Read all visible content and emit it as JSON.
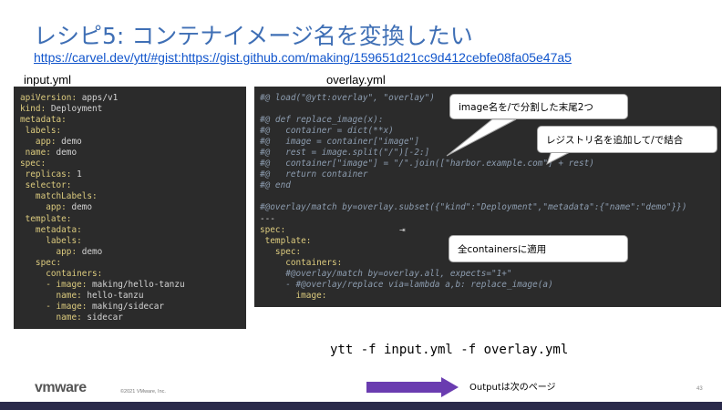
{
  "slide": {
    "title": "レシピ5: コンテナイメージ名を変換したい",
    "link": "https://carvel.dev/ytt/#gist:https://gist.github.com/making/159651d21cc9d412cebfe08fa05e47a5",
    "left_label": "input.yml",
    "right_label": "overlay.yml",
    "command": "ytt -f input.yml -f overlay.yml",
    "next_page": "Outputは次のページ",
    "copyright": "©2021 VMware, Inc.",
    "logo": "vmware",
    "page_number": "43"
  },
  "input_yml": [
    [
      {
        "t": "apiVersion:",
        "c": "k"
      },
      {
        "t": " apps/v1",
        "c": "v"
      }
    ],
    [
      {
        "t": "kind:",
        "c": "k"
      },
      {
        "t": " Deployment",
        "c": "v"
      }
    ],
    [
      {
        "t": "metadata:",
        "c": "k"
      }
    ],
    [
      {
        "t": " labels:",
        "c": "k"
      }
    ],
    [
      {
        "t": "   app:",
        "c": "k"
      },
      {
        "t": " demo",
        "c": "v"
      }
    ],
    [
      {
        "t": " name:",
        "c": "k"
      },
      {
        "t": " demo",
        "c": "v"
      }
    ],
    [
      {
        "t": "spec:",
        "c": "k"
      }
    ],
    [
      {
        "t": " replicas:",
        "c": "k"
      },
      {
        "t": " 1",
        "c": "v"
      }
    ],
    [
      {
        "t": " selector:",
        "c": "k"
      }
    ],
    [
      {
        "t": "   matchLabels:",
        "c": "k"
      }
    ],
    [
      {
        "t": "     app:",
        "c": "k"
      },
      {
        "t": " demo",
        "c": "v"
      }
    ],
    [
      {
        "t": " template:",
        "c": "k"
      }
    ],
    [
      {
        "t": "   metadata:",
        "c": "k"
      }
    ],
    [
      {
        "t": "     labels:",
        "c": "k"
      }
    ],
    [
      {
        "t": "       app:",
        "c": "k"
      },
      {
        "t": " demo",
        "c": "v"
      }
    ],
    [
      {
        "t": "   spec:",
        "c": "k"
      }
    ],
    [
      {
        "t": "     containers:",
        "c": "k"
      }
    ],
    [
      {
        "t": "     - image:",
        "c": "k"
      },
      {
        "t": " making/hello-tanzu",
        "c": "v"
      }
    ],
    [
      {
        "t": "       name:",
        "c": "k"
      },
      {
        "t": " hello-tanzu",
        "c": "v"
      }
    ],
    [
      {
        "t": "     - image:",
        "c": "k"
      },
      {
        "t": " making/sidecar",
        "c": "v"
      }
    ],
    [
      {
        "t": "       name:",
        "c": "k"
      },
      {
        "t": " sidecar",
        "c": "v"
      }
    ]
  ],
  "overlay_yml": [
    [
      {
        "t": "#@ load(\"@ytt:overlay\", \"overlay\")",
        "c": "cm"
      }
    ],
    [
      {
        "t": "",
        "c": "v"
      }
    ],
    [
      {
        "t": "#@ def replace_image(x):",
        "c": "cm"
      }
    ],
    [
      {
        "t": "#@   container = dict(**x)",
        "c": "cm"
      }
    ],
    [
      {
        "t": "#@   image = container[\"image\"]",
        "c": "cm"
      }
    ],
    [
      {
        "t": "#@   rest = image.split(\"/\")[-2:]",
        "c": "cm"
      }
    ],
    [
      {
        "t": "#@   container[\"image\"] = \"/\".join([\"harbor.example.com\"] + rest)",
        "c": "cm"
      }
    ],
    [
      {
        "t": "#@   return container",
        "c": "cm"
      }
    ],
    [
      {
        "t": "#@ end",
        "c": "cm"
      }
    ],
    [
      {
        "t": "",
        "c": "v"
      }
    ],
    [
      {
        "t": "#@overlay/match by=overlay.subset({\"kind\":\"Deployment\",\"metadata\":{\"name\":\"demo\"}})",
        "c": "cm"
      }
    ],
    [
      {
        "t": "---",
        "c": "v"
      }
    ],
    [
      {
        "t": "spec:",
        "c": "k"
      }
    ],
    [
      {
        "t": " template:",
        "c": "k"
      }
    ],
    [
      {
        "t": "   spec:",
        "c": "k"
      }
    ],
    [
      {
        "t": "     containers:",
        "c": "k"
      }
    ],
    [
      {
        "t": "     #@overlay/match by=overlay.all, expects=\"1+\"",
        "c": "cm"
      }
    ],
    [
      {
        "t": "     - #@overlay/replace via=lambda a,b: replace_image(a)",
        "c": "cm"
      }
    ],
    [
      {
        "t": "       image:",
        "c": "k"
      }
    ]
  ],
  "callouts": {
    "split": "image名を/で分割した末尾2つ",
    "registry": "レジストリ名を追加して/で結合",
    "apply": "全containersに適用"
  },
  "colors": {
    "title": "#3f6fb5",
    "code_bg": "#2b2b2b",
    "key": "#dccb7e",
    "comment": "#8d9db0",
    "arrow": "#6a3cb0",
    "footer": "#2a2a4a"
  }
}
